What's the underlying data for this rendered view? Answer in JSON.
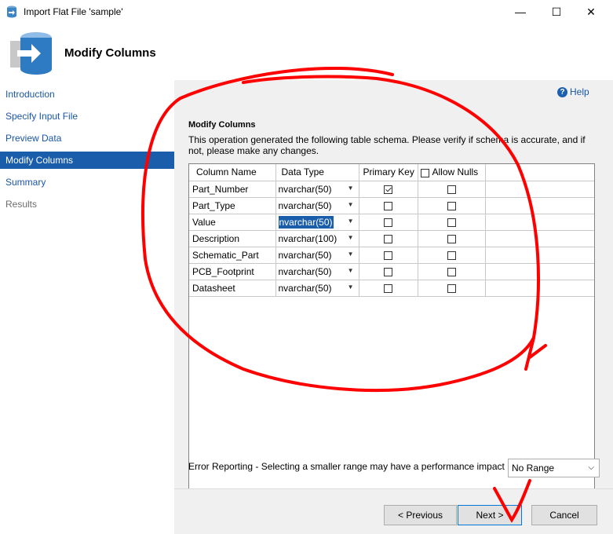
{
  "window": {
    "title": "Import Flat File 'sample'",
    "minimize": "—",
    "maximize": "☐",
    "close": "✕"
  },
  "header": {
    "title": "Modify Columns"
  },
  "sidebar": {
    "items": [
      {
        "label": "Introduction",
        "state": "link"
      },
      {
        "label": "Specify Input File",
        "state": "link"
      },
      {
        "label": "Preview Data",
        "state": "link"
      },
      {
        "label": "Modify Columns",
        "state": "active"
      },
      {
        "label": "Summary",
        "state": "link"
      },
      {
        "label": "Results",
        "state": "disabled"
      }
    ]
  },
  "main": {
    "help_label": "Help",
    "section_title": "Modify Columns",
    "description": "This operation generated the following table schema. Please verify if schema is accurate, and if not, please make any changes.",
    "grid": {
      "headers": {
        "column_name": "Column Name",
        "data_type": "Data Type",
        "primary_key": "Primary Key",
        "allow_nulls": "Allow Nulls"
      },
      "rows": [
        {
          "name": "Part_Number",
          "type": "nvarchar(50)",
          "pk": true,
          "nulls": false,
          "selected": false
        },
        {
          "name": "Part_Type",
          "type": "nvarchar(50)",
          "pk": false,
          "nulls": false,
          "selected": false
        },
        {
          "name": "Value",
          "type": "nvarchar(50)",
          "pk": false,
          "nulls": false,
          "selected": true
        },
        {
          "name": "Description",
          "type": "nvarchar(100)",
          "pk": false,
          "nulls": false,
          "selected": false
        },
        {
          "name": "Schematic_Part",
          "type": "nvarchar(50)",
          "pk": false,
          "nulls": false,
          "selected": false
        },
        {
          "name": "PCB_Footprint",
          "type": "nvarchar(50)",
          "pk": false,
          "nulls": false,
          "selected": false
        },
        {
          "name": "Datasheet",
          "type": "nvarchar(50)",
          "pk": false,
          "nulls": false,
          "selected": false
        }
      ]
    },
    "error_reporting_label": "Error Reporting - Selecting a smaller range may have a performance impact",
    "error_range_value": "No Range"
  },
  "footer": {
    "previous": "< Previous",
    "next": "Next >",
    "cancel": "Cancel"
  },
  "colors": {
    "accent": "#1a5dab",
    "link": "#1a56a6",
    "annotation": "#ff0000"
  }
}
